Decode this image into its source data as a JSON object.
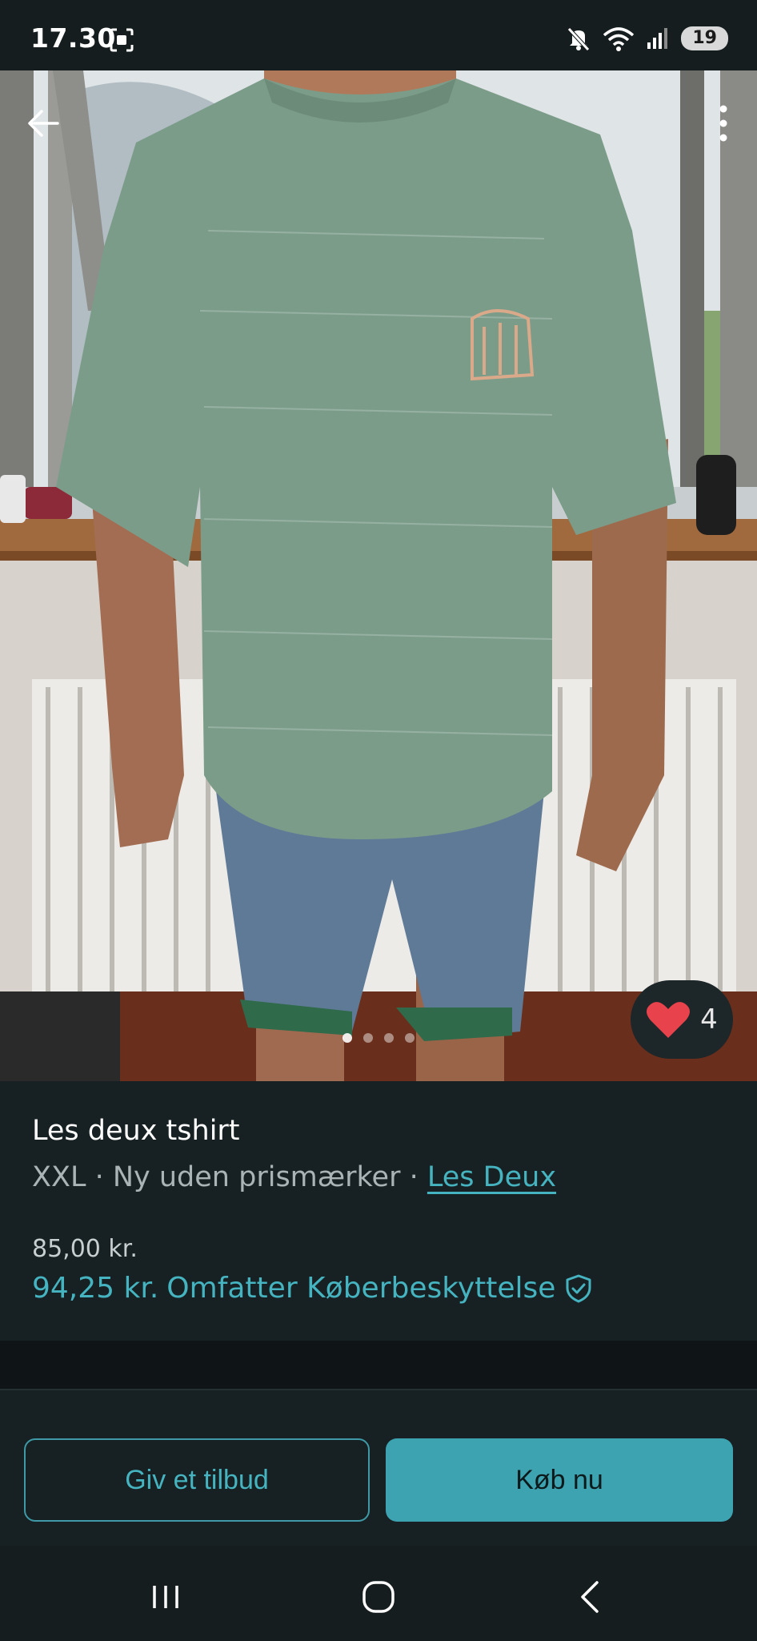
{
  "status_bar": {
    "time": "17.30",
    "battery": "19"
  },
  "photo": {
    "carousel": {
      "pages": 4,
      "active": 1
    }
  },
  "favorite": {
    "count": "4"
  },
  "item": {
    "title": "Les deux tshirt",
    "size": "XXL",
    "separator": " · ",
    "condition": "Ny uden prismærker",
    "brand": "Les Deux",
    "price": "85,00 kr.",
    "price_total": "94,25 kr.",
    "protection_label": "Omfatter Køberbeskyttelse"
  },
  "actions": {
    "offer_label": "Giv et tilbud",
    "buy_label": "Køb nu"
  },
  "colors": {
    "accent": "#45b4c0",
    "background": "#172022",
    "favorite_heart": "#e8434c"
  }
}
